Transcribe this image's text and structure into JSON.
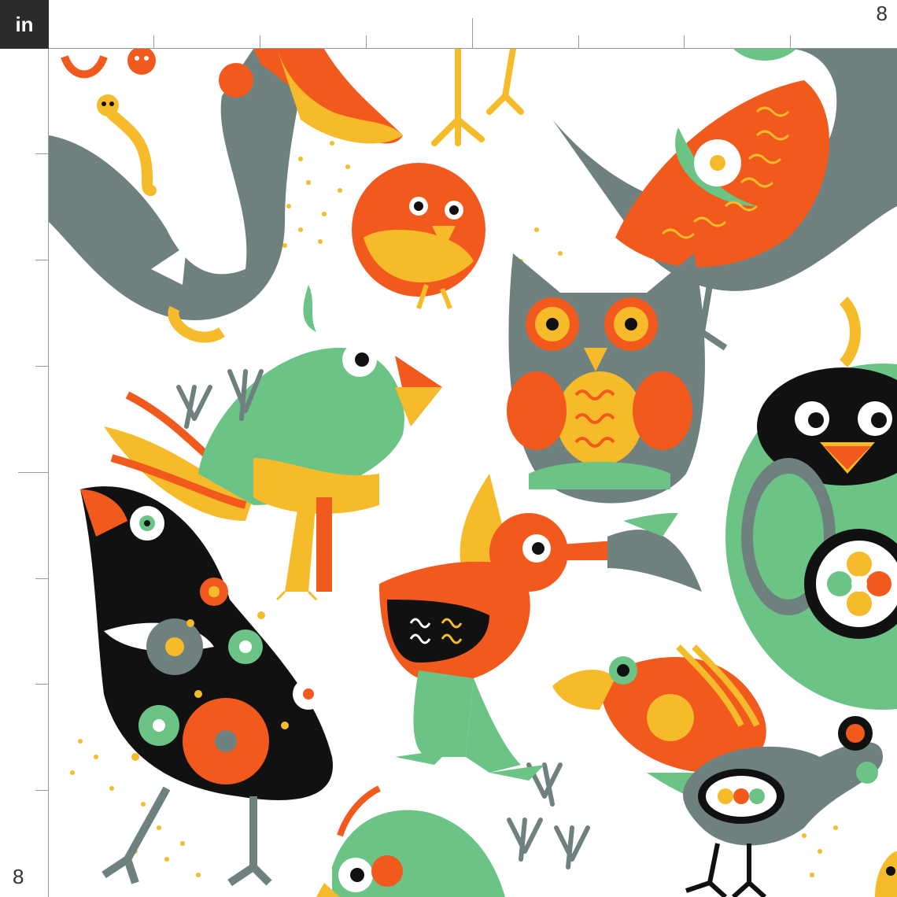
{
  "ruler": {
    "unit_label": "in",
    "top_end_label": "8",
    "left_end_label": "8"
  },
  "fabric": {
    "motifs": [
      "rooster-bird",
      "chick",
      "owl",
      "parrot",
      "black-folk-bird",
      "duck",
      "round-bird",
      "toucan",
      "peacock-bird",
      "worm",
      "bird-footprints"
    ],
    "palette": {
      "orange": "#f2591c",
      "yellow": "#f5bb2a",
      "green": "#6cc386",
      "grey": "#6f817e",
      "black": "#111111",
      "white": "#ffffff"
    }
  }
}
